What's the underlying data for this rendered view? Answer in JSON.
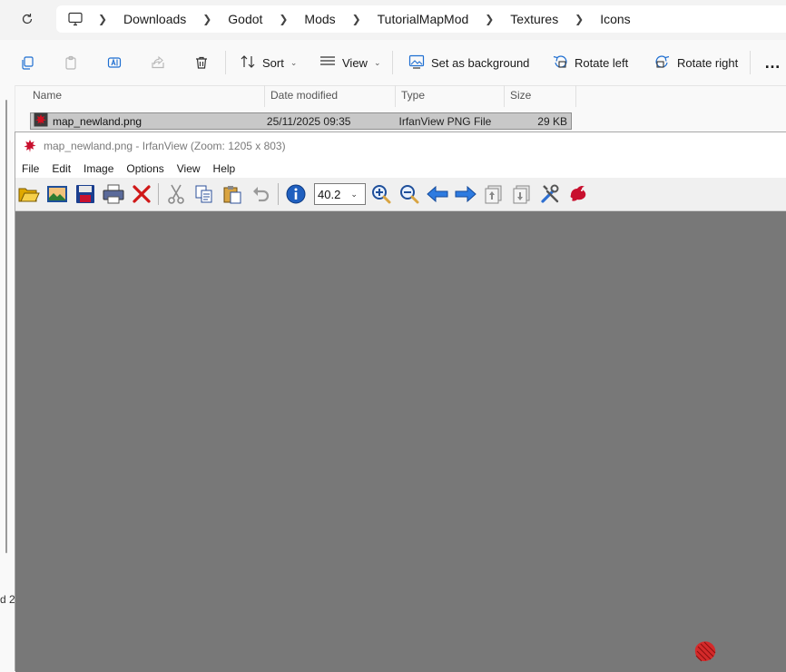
{
  "explorer": {
    "breadcrumb": [
      "Downloads",
      "Godot",
      "Mods",
      "TutorialMapMod",
      "Textures",
      "Icons"
    ],
    "icons": {
      "refresh": "refresh-icon",
      "pc": "this-pc-icon"
    },
    "commands": {
      "sort_label": "Sort",
      "view_label": "View",
      "set_background_label": "Set as background",
      "rotate_left_label": "Rotate left",
      "rotate_right_label": "Rotate right",
      "more_label": "…"
    },
    "columns": [
      "Name",
      "Date modified",
      "Type",
      "Size"
    ],
    "file": {
      "name": "map_newland.png",
      "date_modified": "25/11/2025 09:35",
      "type": "IrfanView PNG File",
      "size": "29 KB"
    },
    "status_fragment": "d 2"
  },
  "irfanview": {
    "title": "map_newland.png - IrfanView (Zoom: 1205 x 803)",
    "menu": [
      "File",
      "Edit",
      "Image",
      "Options",
      "View",
      "Help"
    ],
    "zoom_value": "40.2",
    "canvas_color": "#787878"
  },
  "colors": {
    "selection_bg": "#c8c8c8",
    "irfan_red": "#c8102e",
    "toolbar_blue": "#1f6fd1"
  }
}
